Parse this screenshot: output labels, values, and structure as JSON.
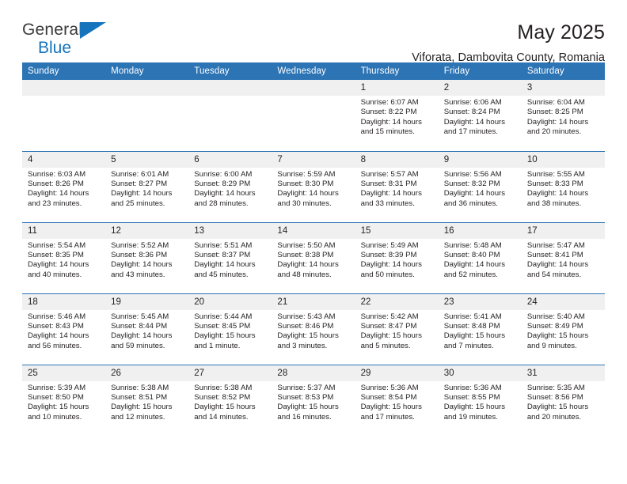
{
  "brand": {
    "line1": "General",
    "line2": "Blue",
    "icon": "triangle-logo"
  },
  "header": {
    "title": "May 2025",
    "subtitle": "Viforata, Dambovita County, Romania"
  },
  "calendar": {
    "weekday_headers": [
      "Sunday",
      "Monday",
      "Tuesday",
      "Wednesday",
      "Thursday",
      "Friday",
      "Saturday"
    ],
    "accent_color": "#2d74b5",
    "daynum_bg": "#f0f0f0",
    "weeks": [
      [
        {
          "day": "",
          "sunrise": "",
          "sunset": "",
          "daylight1": "",
          "daylight2": ""
        },
        {
          "day": "",
          "sunrise": "",
          "sunset": "",
          "daylight1": "",
          "daylight2": ""
        },
        {
          "day": "",
          "sunrise": "",
          "sunset": "",
          "daylight1": "",
          "daylight2": ""
        },
        {
          "day": "",
          "sunrise": "",
          "sunset": "",
          "daylight1": "",
          "daylight2": ""
        },
        {
          "day": "1",
          "sunrise": "Sunrise: 6:07 AM",
          "sunset": "Sunset: 8:22 PM",
          "daylight1": "Daylight: 14 hours",
          "daylight2": "and 15 minutes."
        },
        {
          "day": "2",
          "sunrise": "Sunrise: 6:06 AM",
          "sunset": "Sunset: 8:24 PM",
          "daylight1": "Daylight: 14 hours",
          "daylight2": "and 17 minutes."
        },
        {
          "day": "3",
          "sunrise": "Sunrise: 6:04 AM",
          "sunset": "Sunset: 8:25 PM",
          "daylight1": "Daylight: 14 hours",
          "daylight2": "and 20 minutes."
        }
      ],
      [
        {
          "day": "4",
          "sunrise": "Sunrise: 6:03 AM",
          "sunset": "Sunset: 8:26 PM",
          "daylight1": "Daylight: 14 hours",
          "daylight2": "and 23 minutes."
        },
        {
          "day": "5",
          "sunrise": "Sunrise: 6:01 AM",
          "sunset": "Sunset: 8:27 PM",
          "daylight1": "Daylight: 14 hours",
          "daylight2": "and 25 minutes."
        },
        {
          "day": "6",
          "sunrise": "Sunrise: 6:00 AM",
          "sunset": "Sunset: 8:29 PM",
          "daylight1": "Daylight: 14 hours",
          "daylight2": "and 28 minutes."
        },
        {
          "day": "7",
          "sunrise": "Sunrise: 5:59 AM",
          "sunset": "Sunset: 8:30 PM",
          "daylight1": "Daylight: 14 hours",
          "daylight2": "and 30 minutes."
        },
        {
          "day": "8",
          "sunrise": "Sunrise: 5:57 AM",
          "sunset": "Sunset: 8:31 PM",
          "daylight1": "Daylight: 14 hours",
          "daylight2": "and 33 minutes."
        },
        {
          "day": "9",
          "sunrise": "Sunrise: 5:56 AM",
          "sunset": "Sunset: 8:32 PM",
          "daylight1": "Daylight: 14 hours",
          "daylight2": "and 36 minutes."
        },
        {
          "day": "10",
          "sunrise": "Sunrise: 5:55 AM",
          "sunset": "Sunset: 8:33 PM",
          "daylight1": "Daylight: 14 hours",
          "daylight2": "and 38 minutes."
        }
      ],
      [
        {
          "day": "11",
          "sunrise": "Sunrise: 5:54 AM",
          "sunset": "Sunset: 8:35 PM",
          "daylight1": "Daylight: 14 hours",
          "daylight2": "and 40 minutes."
        },
        {
          "day": "12",
          "sunrise": "Sunrise: 5:52 AM",
          "sunset": "Sunset: 8:36 PM",
          "daylight1": "Daylight: 14 hours",
          "daylight2": "and 43 minutes."
        },
        {
          "day": "13",
          "sunrise": "Sunrise: 5:51 AM",
          "sunset": "Sunset: 8:37 PM",
          "daylight1": "Daylight: 14 hours",
          "daylight2": "and 45 minutes."
        },
        {
          "day": "14",
          "sunrise": "Sunrise: 5:50 AM",
          "sunset": "Sunset: 8:38 PM",
          "daylight1": "Daylight: 14 hours",
          "daylight2": "and 48 minutes."
        },
        {
          "day": "15",
          "sunrise": "Sunrise: 5:49 AM",
          "sunset": "Sunset: 8:39 PM",
          "daylight1": "Daylight: 14 hours",
          "daylight2": "and 50 minutes."
        },
        {
          "day": "16",
          "sunrise": "Sunrise: 5:48 AM",
          "sunset": "Sunset: 8:40 PM",
          "daylight1": "Daylight: 14 hours",
          "daylight2": "and 52 minutes."
        },
        {
          "day": "17",
          "sunrise": "Sunrise: 5:47 AM",
          "sunset": "Sunset: 8:41 PM",
          "daylight1": "Daylight: 14 hours",
          "daylight2": "and 54 minutes."
        }
      ],
      [
        {
          "day": "18",
          "sunrise": "Sunrise: 5:46 AM",
          "sunset": "Sunset: 8:43 PM",
          "daylight1": "Daylight: 14 hours",
          "daylight2": "and 56 minutes."
        },
        {
          "day": "19",
          "sunrise": "Sunrise: 5:45 AM",
          "sunset": "Sunset: 8:44 PM",
          "daylight1": "Daylight: 14 hours",
          "daylight2": "and 59 minutes."
        },
        {
          "day": "20",
          "sunrise": "Sunrise: 5:44 AM",
          "sunset": "Sunset: 8:45 PM",
          "daylight1": "Daylight: 15 hours",
          "daylight2": "and 1 minute."
        },
        {
          "day": "21",
          "sunrise": "Sunrise: 5:43 AM",
          "sunset": "Sunset: 8:46 PM",
          "daylight1": "Daylight: 15 hours",
          "daylight2": "and 3 minutes."
        },
        {
          "day": "22",
          "sunrise": "Sunrise: 5:42 AM",
          "sunset": "Sunset: 8:47 PM",
          "daylight1": "Daylight: 15 hours",
          "daylight2": "and 5 minutes."
        },
        {
          "day": "23",
          "sunrise": "Sunrise: 5:41 AM",
          "sunset": "Sunset: 8:48 PM",
          "daylight1": "Daylight: 15 hours",
          "daylight2": "and 7 minutes."
        },
        {
          "day": "24",
          "sunrise": "Sunrise: 5:40 AM",
          "sunset": "Sunset: 8:49 PM",
          "daylight1": "Daylight: 15 hours",
          "daylight2": "and 9 minutes."
        }
      ],
      [
        {
          "day": "25",
          "sunrise": "Sunrise: 5:39 AM",
          "sunset": "Sunset: 8:50 PM",
          "daylight1": "Daylight: 15 hours",
          "daylight2": "and 10 minutes."
        },
        {
          "day": "26",
          "sunrise": "Sunrise: 5:38 AM",
          "sunset": "Sunset: 8:51 PM",
          "daylight1": "Daylight: 15 hours",
          "daylight2": "and 12 minutes."
        },
        {
          "day": "27",
          "sunrise": "Sunrise: 5:38 AM",
          "sunset": "Sunset: 8:52 PM",
          "daylight1": "Daylight: 15 hours",
          "daylight2": "and 14 minutes."
        },
        {
          "day": "28",
          "sunrise": "Sunrise: 5:37 AM",
          "sunset": "Sunset: 8:53 PM",
          "daylight1": "Daylight: 15 hours",
          "daylight2": "and 16 minutes."
        },
        {
          "day": "29",
          "sunrise": "Sunrise: 5:36 AM",
          "sunset": "Sunset: 8:54 PM",
          "daylight1": "Daylight: 15 hours",
          "daylight2": "and 17 minutes."
        },
        {
          "day": "30",
          "sunrise": "Sunrise: 5:36 AM",
          "sunset": "Sunset: 8:55 PM",
          "daylight1": "Daylight: 15 hours",
          "daylight2": "and 19 minutes."
        },
        {
          "day": "31",
          "sunrise": "Sunrise: 5:35 AM",
          "sunset": "Sunset: 8:56 PM",
          "daylight1": "Daylight: 15 hours",
          "daylight2": "and 20 minutes."
        }
      ]
    ]
  }
}
